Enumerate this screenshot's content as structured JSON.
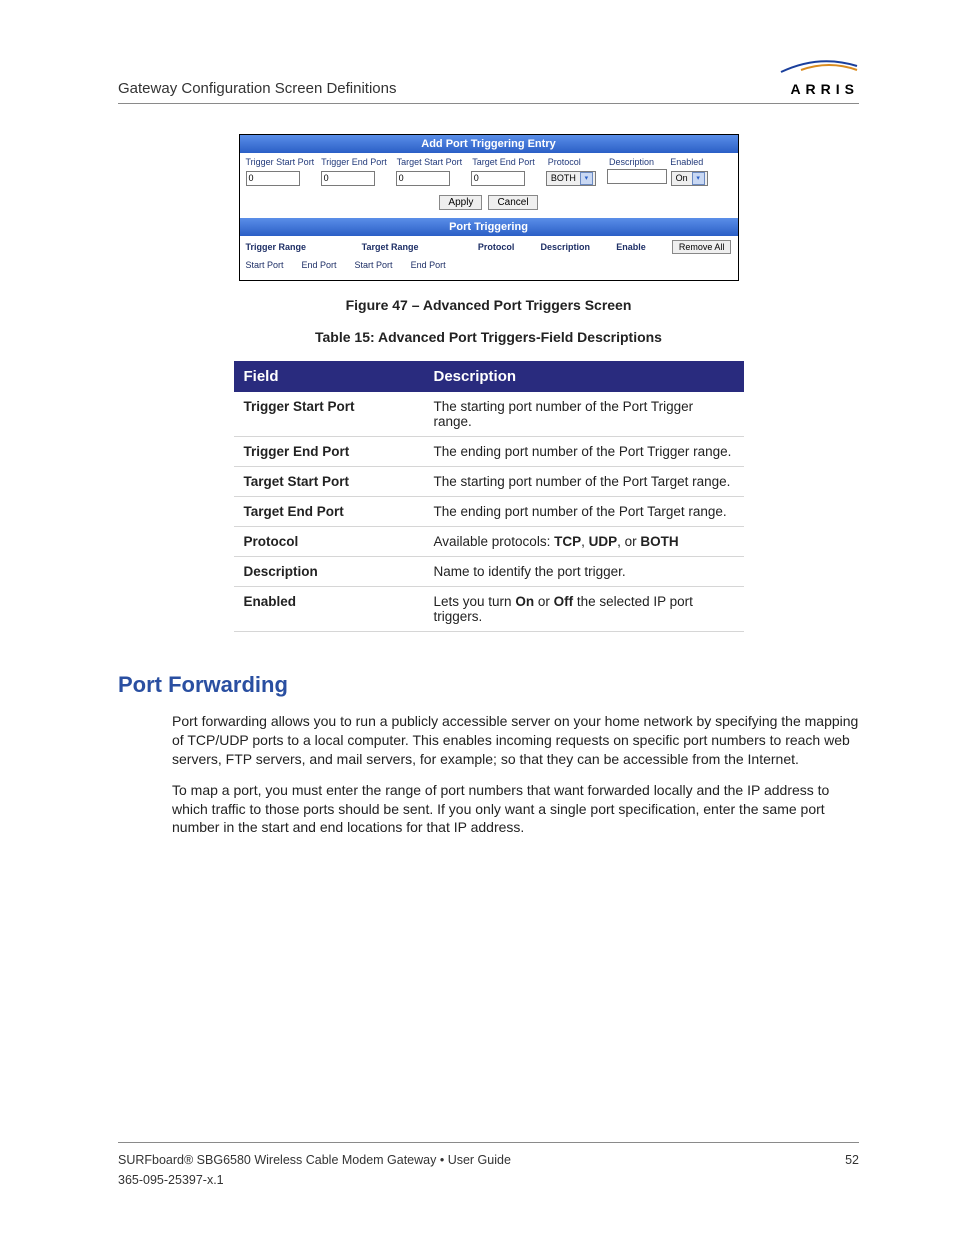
{
  "header": {
    "title": "Gateway Configuration Screen Definitions",
    "logo_text": "ARRIS"
  },
  "screenshot": {
    "bar1": "Add Port Triggering Entry",
    "headers": [
      "Trigger Start Port",
      "Trigger End Port",
      "Target Start Port",
      "Target End Port",
      "Protocol",
      "Description",
      "Enabled"
    ],
    "input_value": "0",
    "protocol_value": "BOTH",
    "enabled_value": "On",
    "apply": "Apply",
    "cancel": "Cancel",
    "bar2": "Port Triggering",
    "sub_headers": {
      "trigger_range": "Trigger Range",
      "target_range": "Target Range",
      "protocol": "Protocol",
      "description": "Description",
      "enable": "Enable",
      "remove_all": "Remove All"
    },
    "sub_row": [
      "Start Port",
      "End Port",
      "Start Port",
      "End Port"
    ]
  },
  "figure_caption": "Figure 47 – Advanced Port Triggers Screen",
  "table_caption": "Table 15: Advanced Port Triggers-Field Descriptions",
  "desc_table": {
    "col_field": "Field",
    "col_desc": "Description",
    "rows": [
      {
        "field": "Trigger Start Port",
        "desc": "The starting port number of the Port Trigger range."
      },
      {
        "field": "Trigger End Port",
        "desc": "The ending port number of the Port Trigger range."
      },
      {
        "field": "Target Start Port",
        "desc": "The starting port number of the Port Target range."
      },
      {
        "field": "Target End Port",
        "desc": "The ending port number of the Port Target range."
      },
      {
        "field": "Protocol",
        "desc_pre": "Available protocols: ",
        "b1": "TCP",
        "sep1": ", ",
        "b2": "UDP",
        "sep2": ", or ",
        "b3": "BOTH"
      },
      {
        "field": "Description",
        "desc": "Name to identify the port trigger."
      },
      {
        "field": "Enabled",
        "desc_pre": "Lets you turn ",
        "b1": "On",
        "sep1": " or ",
        "b2": "Off",
        "desc_post": " the selected IP port triggers."
      }
    ]
  },
  "section": {
    "heading": "Port Forwarding",
    "para1": "Port forwarding allows you to run a publicly accessible server on your home network by specifying the mapping of TCP/UDP ports to a local computer. This enables incoming requests on specific port numbers to reach web servers, FTP servers, and mail servers, for example; so that they can be accessible from the Internet.",
    "para2": "To map a port, you must enter the range of port numbers that want forwarded locally and the IP address to which traffic to those ports should be sent. If you only want a single port specification, enter the same port number in the start and end locations for that IP address."
  },
  "footer": {
    "line1": "SURFboard® SBG6580 Wireless Cable Modem Gateway • User Guide",
    "page": "52",
    "line2": "365-095-25397-x.1"
  }
}
